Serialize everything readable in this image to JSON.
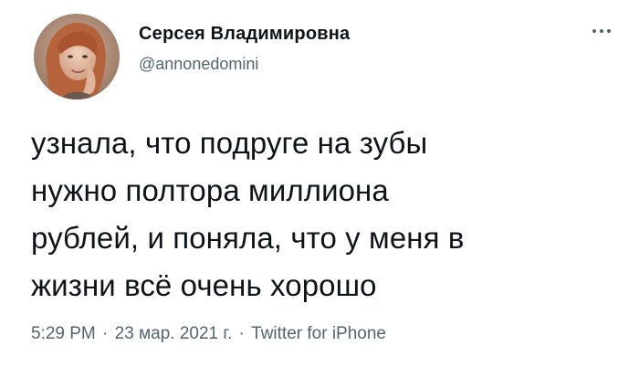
{
  "tweet": {
    "author": {
      "display_name": "Серсея Владимировна",
      "handle": "@annonedomini",
      "avatar_icon": "user-avatar-photo"
    },
    "more_icon": "more-horizontal-icon",
    "text_lines": [
      "узнала, что подруге на зубы",
      "нужно полтора миллиона",
      "рублей, и поняла, что у меня в",
      "жизни всё очень хорошо"
    ],
    "meta": {
      "time": "5:29 PM",
      "separator": "·",
      "date": "23 мар. 2021 г.",
      "source": "Twitter for iPhone"
    }
  },
  "colors": {
    "text": "#0f1419",
    "secondary": "#536471",
    "background": "#ffffff"
  }
}
